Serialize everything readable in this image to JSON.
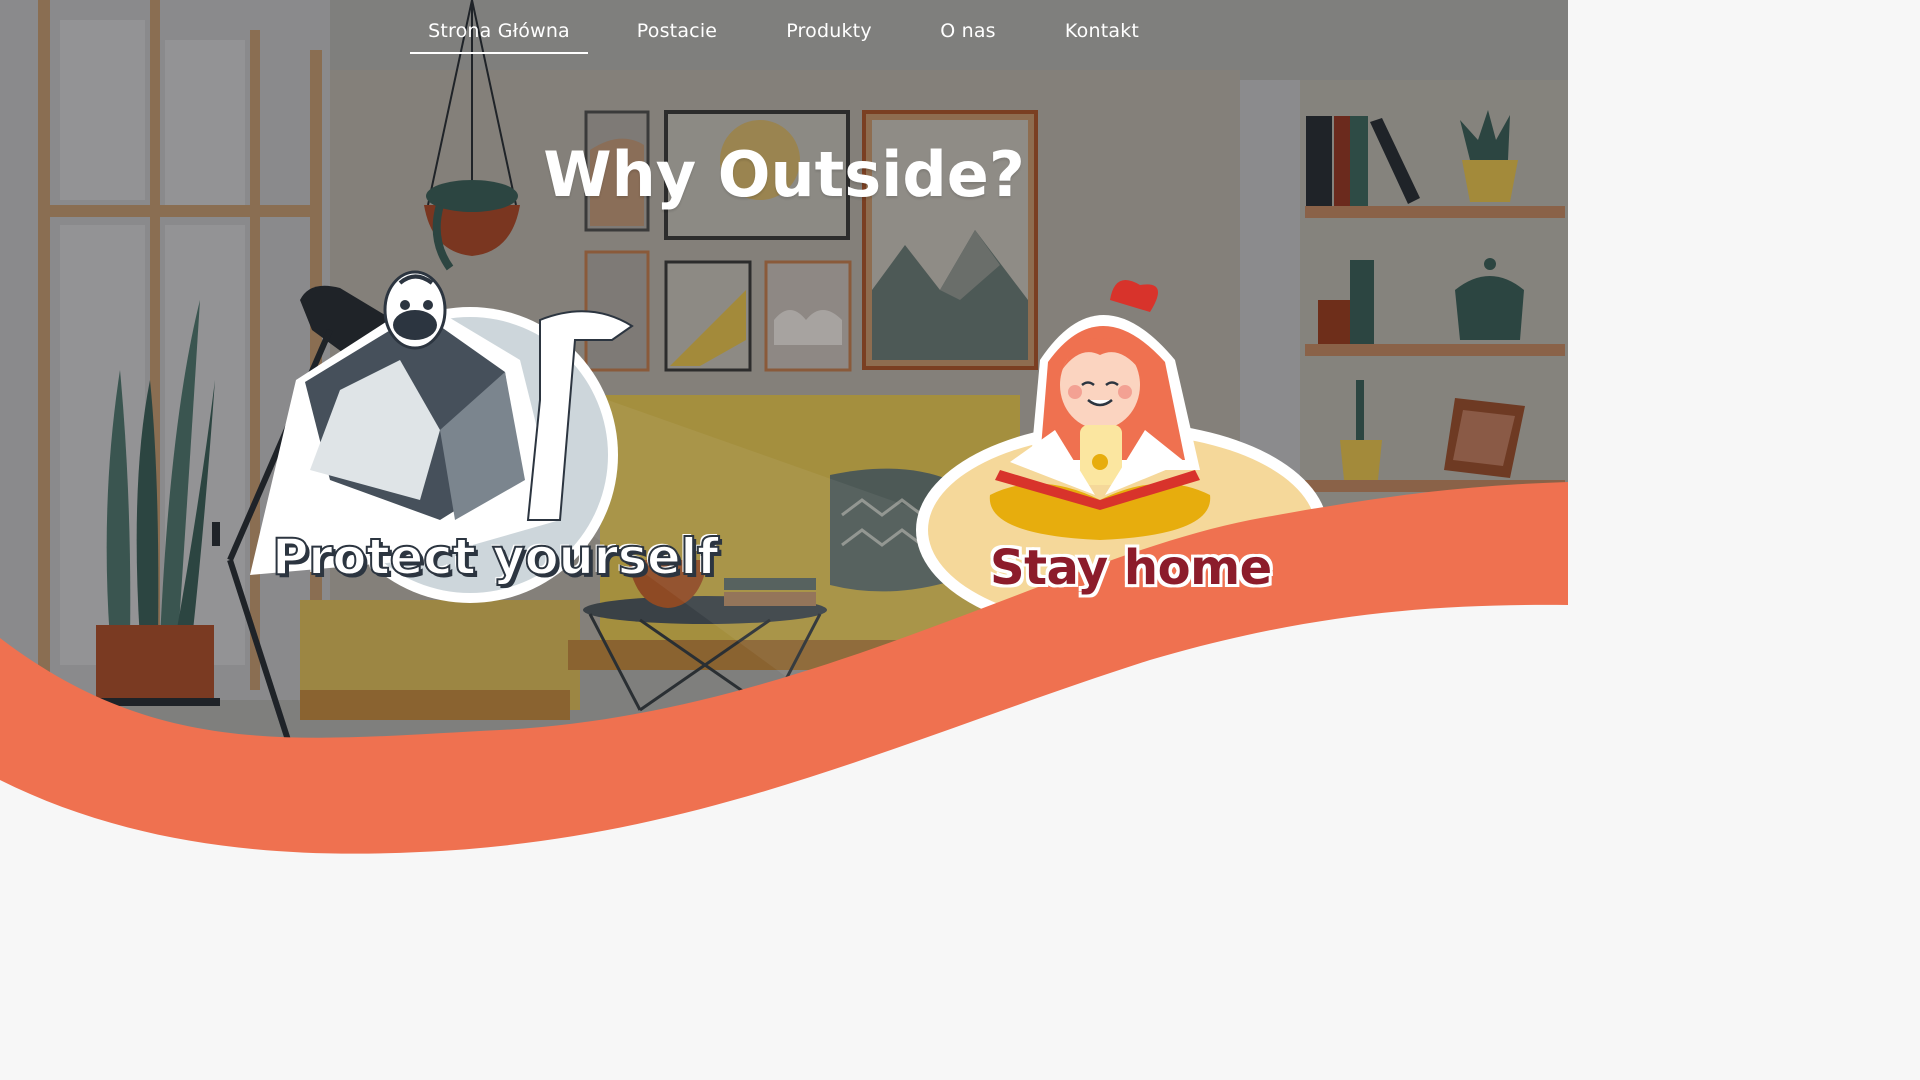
{
  "nav": {
    "items": [
      {
        "label": "Strona Główna",
        "active": true
      },
      {
        "label": "Postacie",
        "active": false
      },
      {
        "label": "Produkty",
        "active": false
      },
      {
        "label": "O nas",
        "active": false
      },
      {
        "label": "Kontakt",
        "active": false
      }
    ]
  },
  "hero": {
    "title": "Why Outside?"
  },
  "stickers": {
    "protect": {
      "label": "Protect yourself",
      "icon": "masked-person-illustration"
    },
    "stay": {
      "label": "Stay home",
      "icon": "girl-reading-book-illustration"
    }
  },
  "colors": {
    "accent_wave": "#ef7150",
    "overlay": "#808080",
    "bottom_bg": "#f7f7f7",
    "stay_text": "#8c1c2b"
  }
}
